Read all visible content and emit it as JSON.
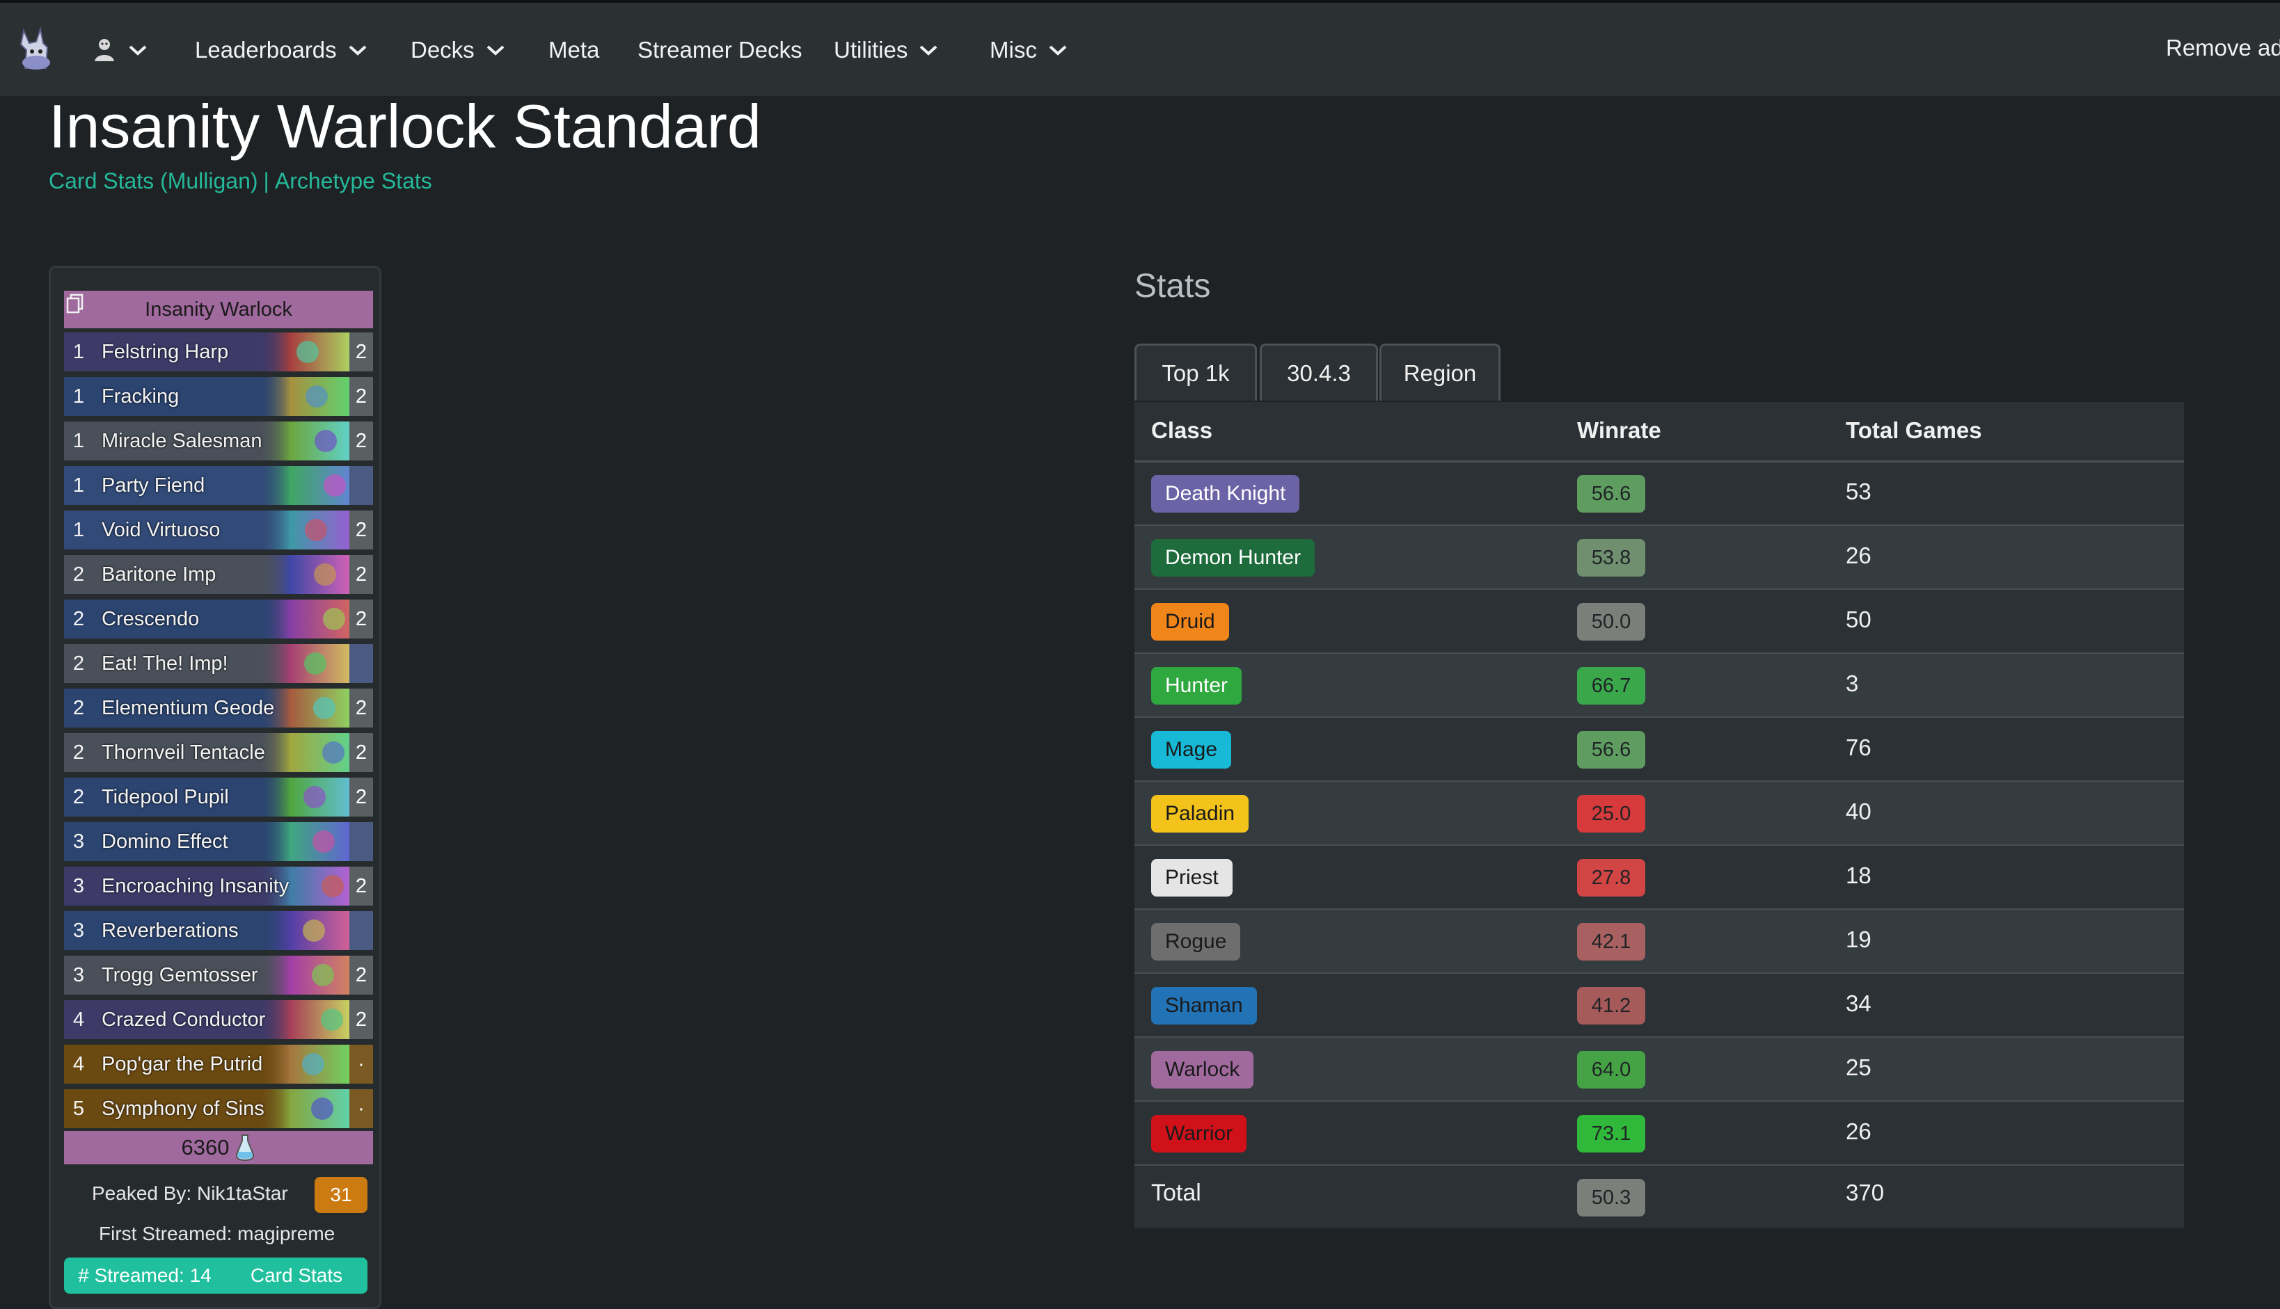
{
  "nav": {
    "items": [
      {
        "label": "Leaderboards",
        "dropdown": true
      },
      {
        "label": "Decks",
        "dropdown": true
      },
      {
        "label": "Meta",
        "dropdown": false
      },
      {
        "label": "Streamer Decks",
        "dropdown": false
      },
      {
        "label": "Utilities",
        "dropdown": true
      },
      {
        "label": "Misc",
        "dropdown": true
      }
    ],
    "remove_ads": "Remove ad"
  },
  "header": {
    "title": "Insanity Warlock Standard",
    "link_card_stats": "Card Stats (Mulligan)",
    "separator": "|",
    "link_archetype_stats": "Archetype Stats"
  },
  "deck": {
    "name": "Insanity Warlock",
    "cards": [
      {
        "cost": "1",
        "name": "Felstring Harp",
        "count": "2",
        "color": "#3d3a68"
      },
      {
        "cost": "1",
        "name": "Fracking",
        "count": "2",
        "color": "#2b4470"
      },
      {
        "cost": "1",
        "name": "Miracle Salesman",
        "count": "2",
        "color": "#4a5059"
      },
      {
        "cost": "1",
        "name": "Party Fiend",
        "count": "",
        "color": "#314a78"
      },
      {
        "cost": "1",
        "name": "Void Virtuoso",
        "count": "2",
        "color": "#324a78"
      },
      {
        "cost": "2",
        "name": "Baritone Imp",
        "count": "2",
        "color": "#4a5059"
      },
      {
        "cost": "2",
        "name": "Crescendo",
        "count": "2",
        "color": "#2b4470"
      },
      {
        "cost": "2",
        "name": "Eat! The! Imp!",
        "count": "",
        "color": "#4a5059"
      },
      {
        "cost": "2",
        "name": "Elementium Geode",
        "count": "2",
        "color": "#2b4470"
      },
      {
        "cost": "2",
        "name": "Thornveil Tentacle",
        "count": "2",
        "color": "#4a5059"
      },
      {
        "cost": "2",
        "name": "Tidepool Pupil",
        "count": "2",
        "color": "#2b4470"
      },
      {
        "cost": "3",
        "name": "Domino Effect",
        "count": "",
        "color": "#2b4470"
      },
      {
        "cost": "3",
        "name": "Encroaching Insanity",
        "count": "2",
        "color": "#3d3a68"
      },
      {
        "cost": "3",
        "name": "Reverberations",
        "count": "",
        "color": "#2b4470"
      },
      {
        "cost": "3",
        "name": "Trogg Gemtosser",
        "count": "2",
        "color": "#4a5059"
      },
      {
        "cost": "4",
        "name": "Crazed Conductor",
        "count": "2",
        "color": "#3d3a68"
      },
      {
        "cost": "4",
        "name": "Pop'gar the Putrid",
        "count": "·",
        "color": "#6b4a12"
      },
      {
        "cost": "5",
        "name": "Symphony of Sins",
        "count": "·",
        "color": "#6b4a12"
      }
    ],
    "dust": "6360",
    "peaked_by": "Peaked By: Nik1taStar",
    "peak_rank": "31",
    "first_streamed": "First Streamed: magipreme",
    "streamed_button": "# Streamed: 14",
    "card_stats_button": "Card Stats"
  },
  "stats": {
    "heading": "Stats",
    "filters": [
      "Top 1k",
      "30.4.3",
      "Region"
    ],
    "columns": [
      "Class",
      "Winrate",
      "Total Games"
    ],
    "rows": [
      {
        "class": "Death Knight",
        "winrate": "56.6",
        "games": "53",
        "class_color": "#6b63a6",
        "class_text": "#ffffff",
        "wr_color": "#5f9c5f"
      },
      {
        "class": "Demon Hunter",
        "winrate": "53.8",
        "games": "26",
        "class_color": "#1e6b3c",
        "class_text": "#ffffff",
        "wr_color": "#6f8f6f"
      },
      {
        "class": "Druid",
        "winrate": "50.0",
        "games": "50",
        "class_color": "#f08519",
        "class_text": "#1a1a1a",
        "wr_color": "#7a7f7a"
      },
      {
        "class": "Hunter",
        "winrate": "66.7",
        "games": "3",
        "class_color": "#2ea83f",
        "class_text": "#ffffff",
        "wr_color": "#3aa84a"
      },
      {
        "class": "Mage",
        "winrate": "56.6",
        "games": "76",
        "class_color": "#17b9d6",
        "class_text": "#1a1a1a",
        "wr_color": "#5f9c5f"
      },
      {
        "class": "Paladin",
        "winrate": "25.0",
        "games": "40",
        "class_color": "#f3c21b",
        "class_text": "#1a1a1a",
        "wr_color": "#d63a3a"
      },
      {
        "class": "Priest",
        "winrate": "27.8",
        "games": "18",
        "class_color": "#e5e5e5",
        "class_text": "#1a1a1a",
        "wr_color": "#d24545"
      },
      {
        "class": "Rogue",
        "winrate": "42.1",
        "games": "19",
        "class_color": "#6e6e6e",
        "class_text": "#1a1a1a",
        "wr_color": "#a86060"
      },
      {
        "class": "Shaman",
        "winrate": "41.2",
        "games": "34",
        "class_color": "#2273b5",
        "class_text": "#1a1a1a",
        "wr_color": "#a65a5a"
      },
      {
        "class": "Warlock",
        "winrate": "64.0",
        "games": "25",
        "class_color": "#a06a9e",
        "class_text": "#1a1a1a",
        "wr_color": "#45a345"
      },
      {
        "class": "Warrior",
        "winrate": "73.1",
        "games": "26",
        "class_color": "#d0111a",
        "class_text": "#1a1a1a",
        "wr_color": "#2fb83a"
      }
    ],
    "total": {
      "label": "Total",
      "winrate": "50.3",
      "games": "370",
      "wr_color": "#7a7f7a"
    }
  }
}
